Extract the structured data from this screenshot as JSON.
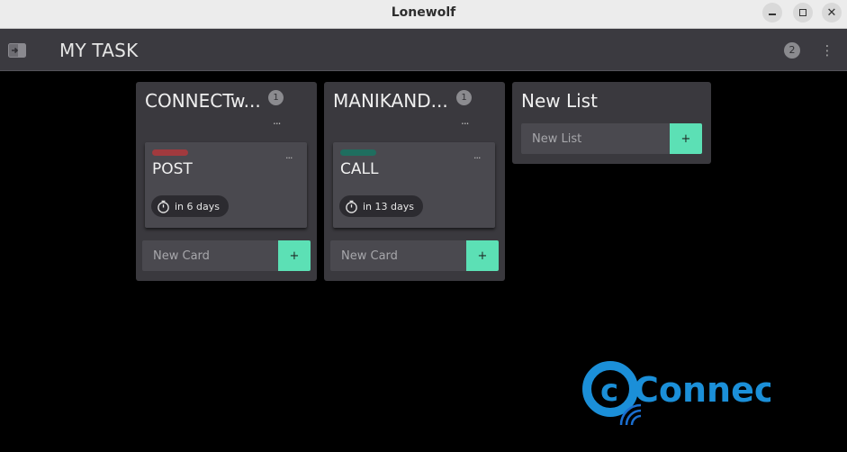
{
  "window": {
    "title": "Lonewolf"
  },
  "app": {
    "title": "MY TASK",
    "badge": "2"
  },
  "lists": [
    {
      "title": "CONNECTw...",
      "count": "1",
      "menu": "...",
      "card": {
        "title": "POST",
        "label_color": "#a13a3e",
        "due": "in 6 days",
        "menu": "..."
      },
      "new_card_placeholder": "New Card",
      "add_label": "+"
    },
    {
      "title": "MANIKAND...",
      "count": "1",
      "menu": "...",
      "card": {
        "title": "CALL",
        "label_color": "#1f6e5f",
        "due": "in 13 days",
        "menu": "..."
      },
      "new_card_placeholder": "New Card",
      "add_label": "+"
    }
  ],
  "new_list": {
    "heading": "New List",
    "placeholder": "New List",
    "add_label": "+"
  },
  "watermark": {
    "text": "Connect",
    "color": "#1b8fd8"
  },
  "colors": {
    "accent": "#5ce0b5",
    "list_bg": "#3a393e",
    "card_bg": "#4a494f"
  }
}
